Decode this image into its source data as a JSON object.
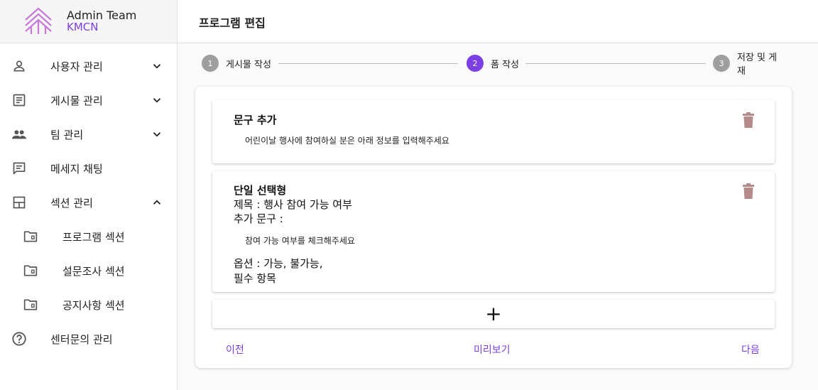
{
  "brand": {
    "team": "Admin Team",
    "org": "KMCN"
  },
  "sidebar": {
    "items": [
      {
        "label": "사용자 관리",
        "icon": "person-icon",
        "chevron": "chevron-down-icon"
      },
      {
        "label": "게시물 관리",
        "icon": "article-icon",
        "chevron": "chevron-down-icon"
      },
      {
        "label": "팀 관리",
        "icon": "group-icon",
        "chevron": "chevron-down-icon"
      },
      {
        "label": "메세지 채팅",
        "icon": "chat-icon"
      },
      {
        "label": "섹션 관리",
        "icon": "layout-icon",
        "chevron": "chevron-up-icon"
      },
      {
        "label": "프로그램 섹션",
        "icon": "folder-icon"
      },
      {
        "label": "설문조사 섹션",
        "icon": "folder-icon"
      },
      {
        "label": "공지사항 섹션",
        "icon": "folder-icon"
      },
      {
        "label": "센터문의 관리",
        "icon": "help-circle-icon"
      }
    ]
  },
  "header": {
    "title": "프로그램 편집"
  },
  "stepper": {
    "steps": [
      {
        "num": "1",
        "label": "게시물 작성",
        "active": false
      },
      {
        "num": "2",
        "label": "폼 작성",
        "active": true
      },
      {
        "num": "3",
        "label": "저장 및 게재",
        "active": false
      }
    ]
  },
  "form": {
    "block1": {
      "title": "문구 추가",
      "text": "어린이날 행사에 참여하실 분은 아래 정보를 입력해주세요"
    },
    "block2": {
      "title": "단일 선택형",
      "subject": "제목 : 행사 참여 가능 여부",
      "extra_label": "추가 문구 :",
      "extra_text": "참여 가능 여부를 체크해주세요",
      "options": "옵션 : 가능,   불가능,",
      "required": "필수 항목"
    },
    "add_symbol": "+"
  },
  "actions": {
    "prev": "이전",
    "preview": "미리보기",
    "next": "다음"
  },
  "colors": {
    "accent": "#7b3fe4",
    "step_inactive": "#9e9e9e",
    "trash": "#b48a8a"
  }
}
